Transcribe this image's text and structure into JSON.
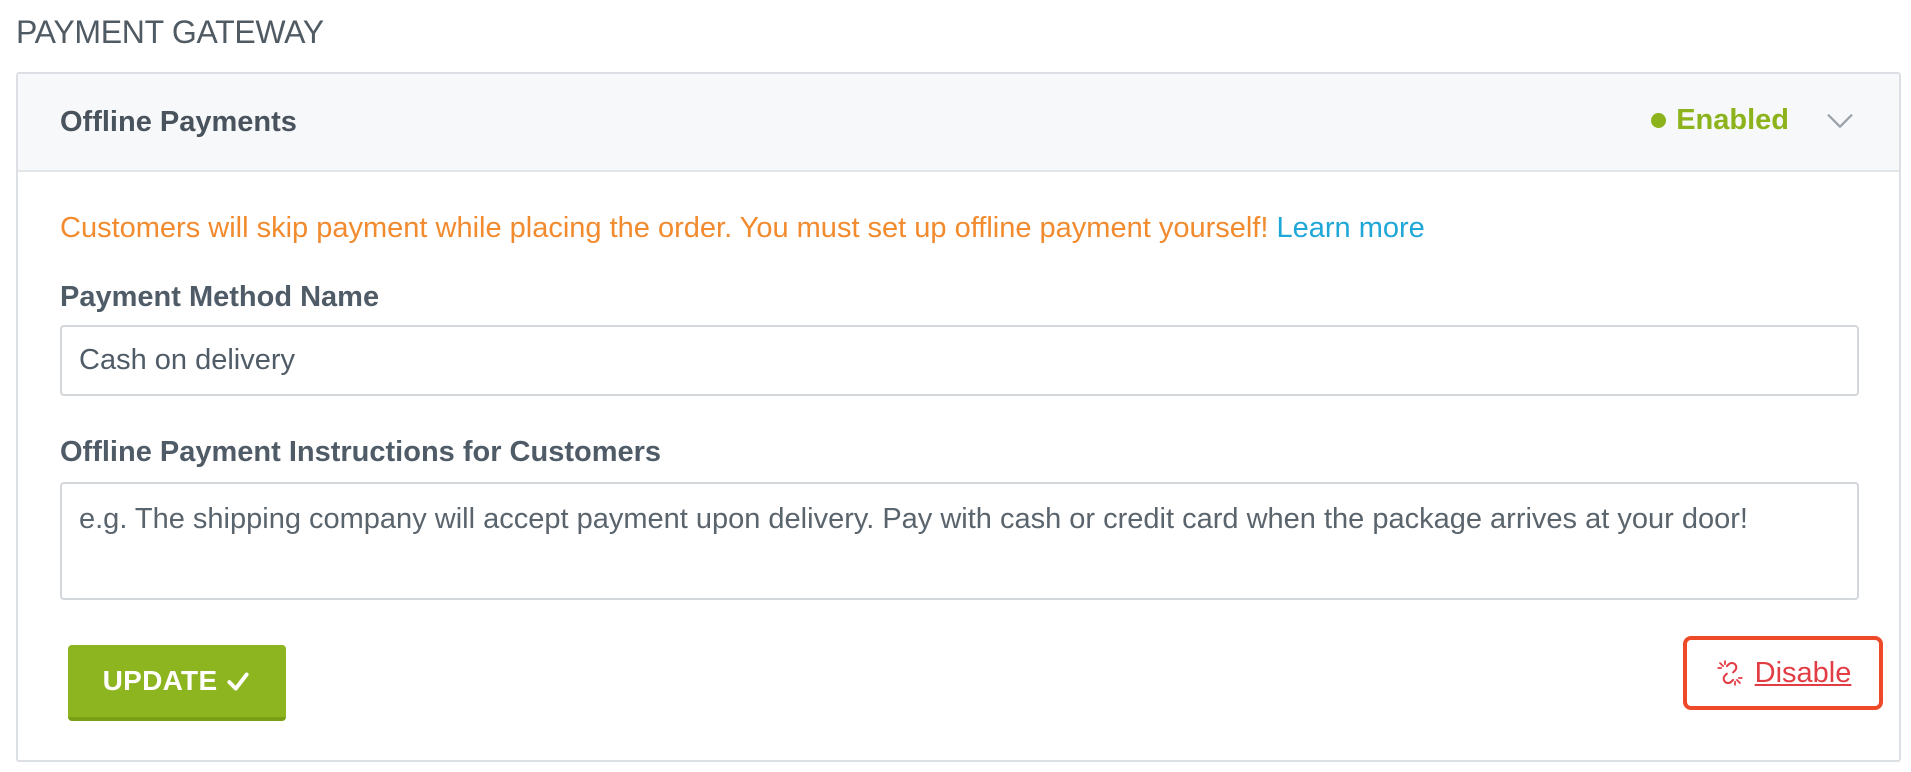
{
  "section": {
    "title": "PAYMENT GATEWAY"
  },
  "card": {
    "title": "Offline Payments",
    "status": {
      "label": "Enabled",
      "color": "#8cb31c"
    },
    "toggle_icon": "chevron-down-icon",
    "notice": {
      "text": "Customers will skip payment while placing the order. You must set up offline payment yourself!",
      "link_label": "Learn more"
    },
    "form": {
      "method_name": {
        "label": "Payment Method Name",
        "value": "Cash on delivery"
      },
      "instructions": {
        "label": "Offline Payment Instructions for Customers",
        "placeholder": "e.g. The shipping company will accept payment upon delivery. Pay with cash or credit card when the package arrives at your door!"
      }
    },
    "actions": {
      "update_label": "UPDATE",
      "update_icon": "check-icon",
      "disable_label": "Disable",
      "disable_icon": "unlink-icon"
    }
  },
  "colors": {
    "accent_green": "#8db51f",
    "link_blue": "#1fa7d8",
    "warning_orange": "#f28a2e",
    "danger_red": "#e23c44",
    "highlight_border": "#ee4a2a"
  }
}
